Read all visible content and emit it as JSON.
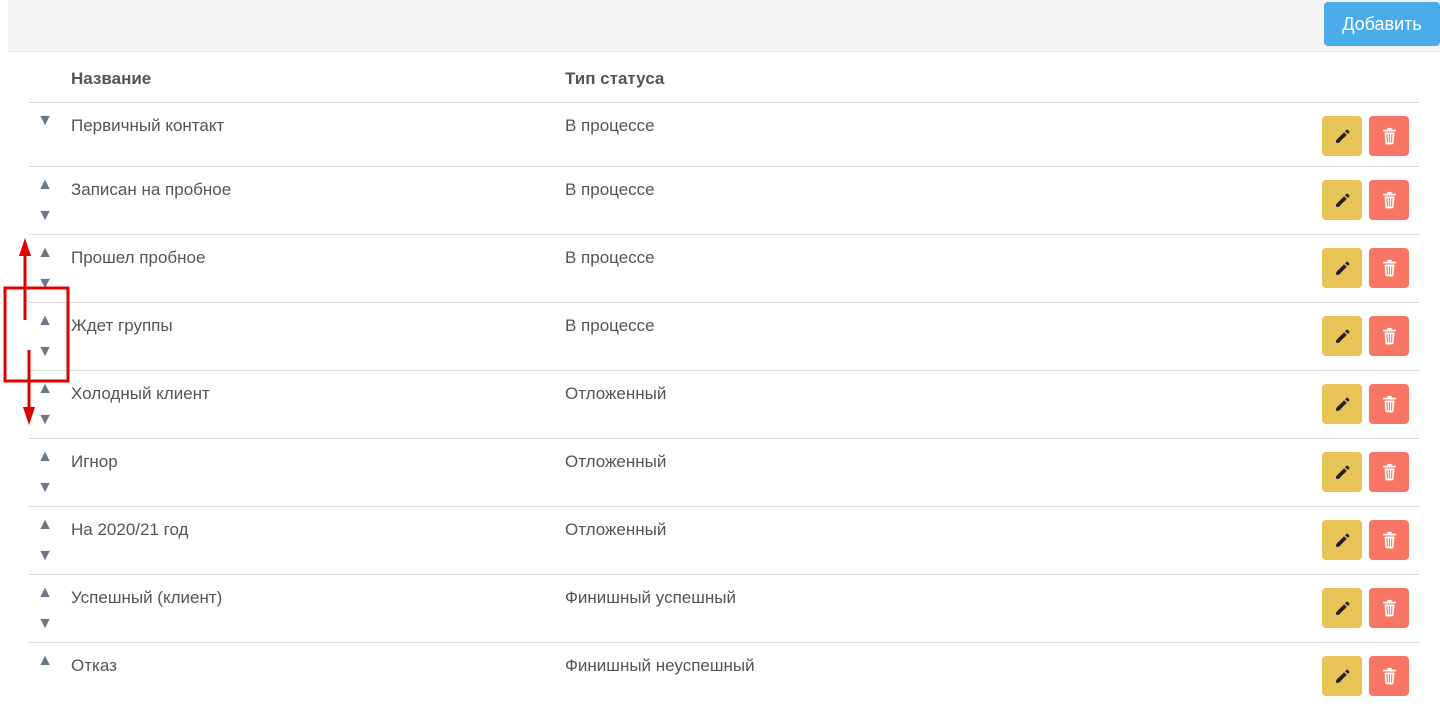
{
  "toolbar": {
    "add_label": "Добавить"
  },
  "table": {
    "columns": [
      "Название",
      "Тип статуса"
    ],
    "rows": [
      {
        "name": "Первичный контакт",
        "type": "В процессе"
      },
      {
        "name": "Записан на пробное",
        "type": "В процессе"
      },
      {
        "name": "Прошел пробное",
        "type": "В процессе"
      },
      {
        "name": "Ждет группы",
        "type": "В процессе"
      },
      {
        "name": "Холодный клиент",
        "type": "Отложенный"
      },
      {
        "name": "Игнор",
        "type": "Отложенный"
      },
      {
        "name": "На 2020/21 год",
        "type": "Отложенный"
      },
      {
        "name": "Успешный (клиент)",
        "type": "Финишный успешный"
      },
      {
        "name": "Отказ",
        "type": "Финишный неуспешный"
      }
    ]
  },
  "colors": {
    "add_button": "#4aade9",
    "edit_button": "#e8c456",
    "delete_button": "#f97566",
    "arrow": "#6b7886",
    "annotation": "#e00000"
  },
  "icons": {
    "move_up": "triangle-up-icon",
    "move_down": "triangle-down-icon",
    "edit": "pencil-icon",
    "delete": "trash-icon"
  }
}
